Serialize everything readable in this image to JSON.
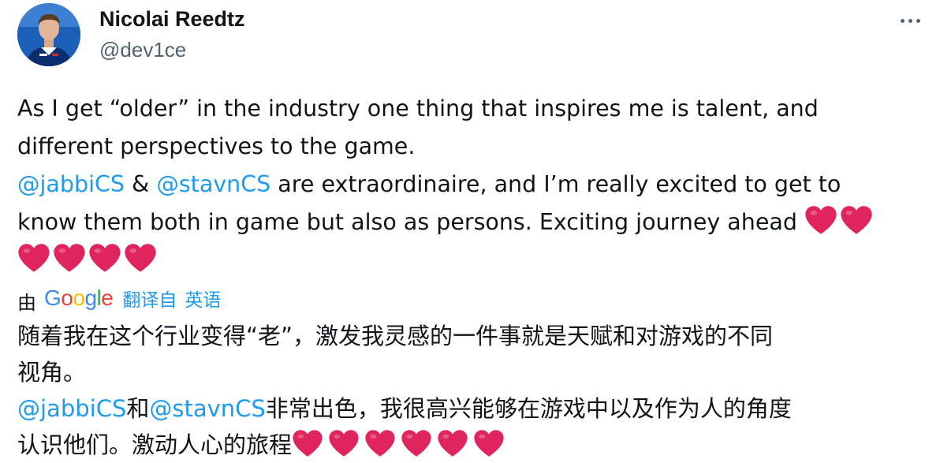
{
  "author": {
    "display_name": "Nicolai Reedtz",
    "handle": "@dev1ce"
  },
  "more_icon": "more-horizontal-icon",
  "tweet": {
    "line1": "As I get “older” in the industry one thing that inspires me is talent, and",
    "line2": "different perspectives to the game.",
    "line3": {
      "mention1": "@jabbiCS",
      "amp": " & ",
      "mention2": "@stavnCS",
      "rest": " are extraordinaire, and I’m really excited to get to"
    },
    "line4": "know them both in game but also as persons. Exciting journey ahead ",
    "heart_emoji": "red-heart-icon"
  },
  "translation": {
    "by_label": "由",
    "provider": "Google",
    "translated_from": "翻译自",
    "source_language": "英语",
    "line1": "随着我在这个行业变得“老”，激发我灵感的一件事就是天赋和对游戏的不同",
    "line2": "视角。",
    "line3": {
      "mention1": "@jabbiCS",
      "and": "和",
      "mention2": "@stavnCS",
      "rest": "非常出色，我很高兴能够在游戏中以及作为人的角度"
    },
    "line4": "认识他们。激动人心的旅程"
  },
  "colors": {
    "text": "#0f1419",
    "secondary": "#536471",
    "link": "#1d9bf0",
    "heart": "#e0245e"
  }
}
